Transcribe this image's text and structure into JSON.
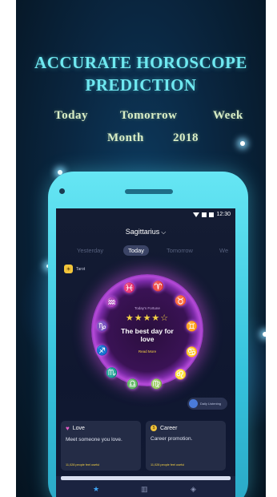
{
  "headline": {
    "line1": "ACCURATE HOROSCOPE",
    "line2": "PREDICTION"
  },
  "periods": {
    "today": "Today",
    "tomorrow": "Tomorrow",
    "week": "Week",
    "month": "Month",
    "year": "2018"
  },
  "status_bar": {
    "time": "12:30"
  },
  "app": {
    "sign_selector": "Sagittarius",
    "tabs": [
      "Yesterday",
      "Today",
      "Tomorrow",
      "We"
    ],
    "active_tab": "Today",
    "tarot_label": "Tarot",
    "fortune": {
      "label": "Today's Fortune",
      "stars": "★★★★☆",
      "title": "The best day for love",
      "read_more": "Read More"
    },
    "zodiac_icons": [
      "♓",
      "♈",
      "♉",
      "♊",
      "♋",
      "♌",
      "♍",
      "♎",
      "♏",
      "♐",
      "♑",
      "♒"
    ],
    "daily_label": "Daily Listening",
    "cards": {
      "love": {
        "title": "Love",
        "text": "Meet someone you love.",
        "useful": "11,028 people feel useful"
      },
      "career": {
        "title": "Career",
        "text": "Career promotion.",
        "useful": "11,028 people feel useful"
      }
    },
    "nav_icons": [
      "star-icon",
      "chart-icon",
      "compass-icon"
    ]
  },
  "colors": {
    "headline": "#6fe8f0",
    "phone": "#4fd5ea",
    "accent": "#f5d244",
    "glow": "#c95ae0"
  }
}
